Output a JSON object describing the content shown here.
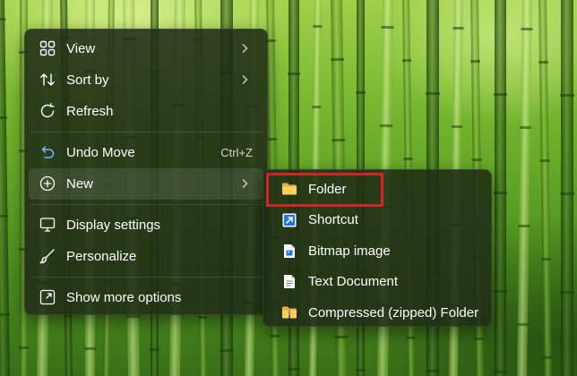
{
  "context_menu": {
    "items": [
      {
        "label": "View",
        "icon": "grid-icon",
        "has_submenu": true
      },
      {
        "label": "Sort by",
        "icon": "sort-arrows-icon",
        "has_submenu": true
      },
      {
        "label": "Refresh",
        "icon": "refresh-icon",
        "has_submenu": false
      },
      {
        "label": "Undo Move",
        "icon": "undo-icon",
        "shortcut": "Ctrl+Z"
      },
      {
        "label": "New",
        "icon": "plus-circle-icon",
        "has_submenu": true,
        "expanded": true
      },
      {
        "label": "Display settings",
        "icon": "display-settings-icon"
      },
      {
        "label": "Personalize",
        "icon": "brush-icon"
      },
      {
        "label": "Show more options",
        "icon": "open-external-icon"
      }
    ]
  },
  "new_submenu": {
    "items": [
      {
        "label": "Folder",
        "icon": "folder-icon",
        "highlighted": true
      },
      {
        "label": "Shortcut",
        "icon": "shortcut-icon"
      },
      {
        "label": "Bitmap image",
        "icon": "bitmap-file-icon"
      },
      {
        "label": "Text Document",
        "icon": "text-document-icon"
      },
      {
        "label": "Compressed (zipped) Folder",
        "icon": "zip-folder-icon"
      }
    ]
  },
  "colors": {
    "menu_background": "#202c16",
    "highlight_outline": "#d4232b",
    "folder_yellow": "#f5c84a",
    "shortcut_blue": "#1a73e8"
  }
}
